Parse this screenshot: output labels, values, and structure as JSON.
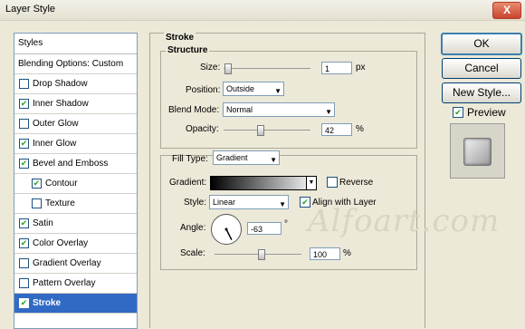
{
  "window": {
    "title": "Layer Style",
    "close_label": "X"
  },
  "styles_panel": {
    "header": "Styles",
    "items": [
      {
        "label": "Blending Options: Custom",
        "checked": null,
        "level": 0,
        "selected": false
      },
      {
        "label": "Drop Shadow",
        "checked": false,
        "level": 0,
        "selected": false
      },
      {
        "label": "Inner Shadow",
        "checked": true,
        "level": 0,
        "selected": false
      },
      {
        "label": "Outer Glow",
        "checked": false,
        "level": 0,
        "selected": false
      },
      {
        "label": "Inner Glow",
        "checked": true,
        "level": 0,
        "selected": false
      },
      {
        "label": "Bevel and Emboss",
        "checked": true,
        "level": 0,
        "selected": false
      },
      {
        "label": "Contour",
        "checked": true,
        "level": 1,
        "selected": false
      },
      {
        "label": "Texture",
        "checked": false,
        "level": 1,
        "selected": false
      },
      {
        "label": "Satin",
        "checked": true,
        "level": 0,
        "selected": false
      },
      {
        "label": "Color Overlay",
        "checked": true,
        "level": 0,
        "selected": false
      },
      {
        "label": "Gradient Overlay",
        "checked": false,
        "level": 0,
        "selected": false
      },
      {
        "label": "Pattern Overlay",
        "checked": false,
        "level": 0,
        "selected": false
      },
      {
        "label": "Stroke",
        "checked": true,
        "level": 0,
        "selected": true
      }
    ]
  },
  "stroke": {
    "title": "Stroke",
    "structure": {
      "title": "Structure",
      "size_label": "Size:",
      "size_value": "1",
      "size_unit": "px",
      "size_fraction": 0.01,
      "position_label": "Position:",
      "position_value": "Outside",
      "blend_label": "Blend Mode:",
      "blend_value": "Normal",
      "opacity_label": "Opacity:",
      "opacity_value": "42",
      "opacity_unit": "%",
      "opacity_fraction": 0.42
    },
    "fill": {
      "type_label": "Fill Type:",
      "type_value": "Gradient",
      "gradient_label": "Gradient:",
      "reverse_label": "Reverse",
      "reverse_checked": false,
      "style_label": "Style:",
      "style_value": "Linear",
      "align_label": "Align with Layer",
      "align_checked": true,
      "angle_label": "Angle:",
      "angle_value": "-63",
      "angle_unit": "°",
      "scale_label": "Scale:",
      "scale_value": "100",
      "scale_unit": "%",
      "scale_fraction": 0.55
    }
  },
  "buttons": {
    "ok": "OK",
    "cancel": "Cancel",
    "new_style": "New Style..."
  },
  "preview": {
    "label": "Preview",
    "checked": true
  },
  "watermark": "Alfoart.com"
}
